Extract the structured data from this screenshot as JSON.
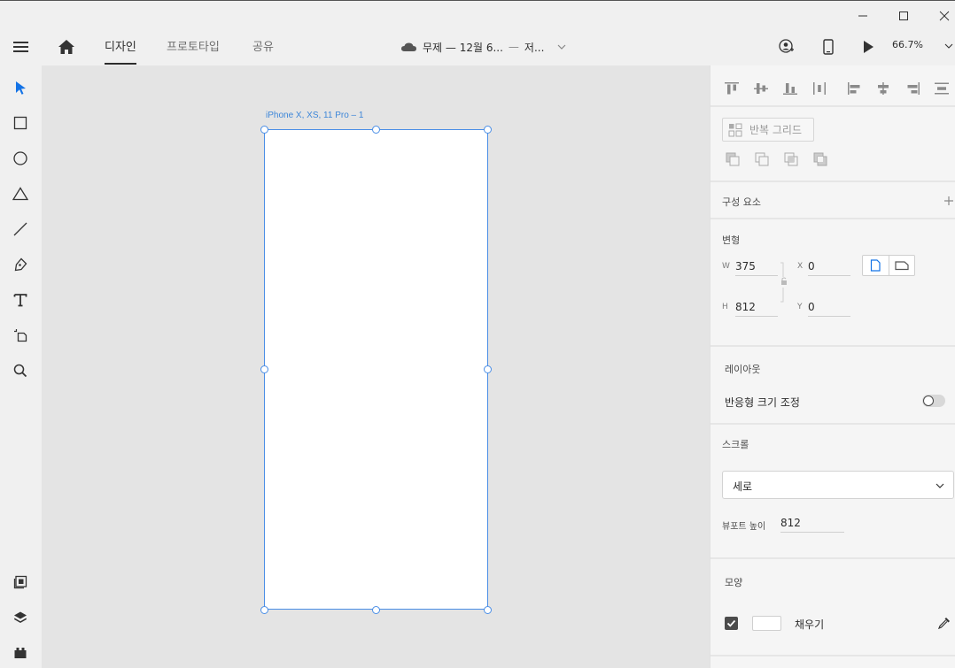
{
  "window": {
    "minimize_icon": "minimize-icon",
    "maximize_icon": "maximize-icon",
    "close_icon": "close-icon"
  },
  "appbar": {
    "tabs": [
      {
        "label": "디자인",
        "active": true
      },
      {
        "label": "프로토타입",
        "active": false
      },
      {
        "label": "공유",
        "active": false
      }
    ],
    "doc_title": "무제 — 12월 6...",
    "save_state": "저...",
    "zoom": "66.7%"
  },
  "tools": [
    "select-icon",
    "rectangle-icon",
    "ellipse-icon",
    "triangle-icon",
    "line-icon",
    "pen-icon",
    "text-icon",
    "artboard-icon",
    "zoom-icon",
    "assets-icon",
    "layers-icon",
    "plugins-icon"
  ],
  "canvas": {
    "artboard_name": "iPhone X, XS, 11 Pro – 1"
  },
  "panel": {
    "repeat_grid_label": "반복 그리드",
    "components_title": "구성 요소",
    "transform": {
      "title": "변형",
      "w_label": "W",
      "w_value": "375",
      "h_label": "H",
      "h_value": "812",
      "x_label": "X",
      "x_value": "0",
      "y_label": "Y",
      "y_value": "0"
    },
    "layout": {
      "title": "레이아웃",
      "responsive_label": "반응형 크기 조정",
      "responsive_on": false
    },
    "scroll": {
      "title": "스크롤",
      "mode": "세로",
      "viewport_label": "뷰포트 높이",
      "viewport_value": "812"
    },
    "appearance": {
      "title": "모양",
      "fill_label": "채우기",
      "fill_checked": true,
      "fill_color": "#ffffff"
    }
  },
  "colors": {
    "accent": "#4a8ee6",
    "select_tool": "#1473e6"
  }
}
